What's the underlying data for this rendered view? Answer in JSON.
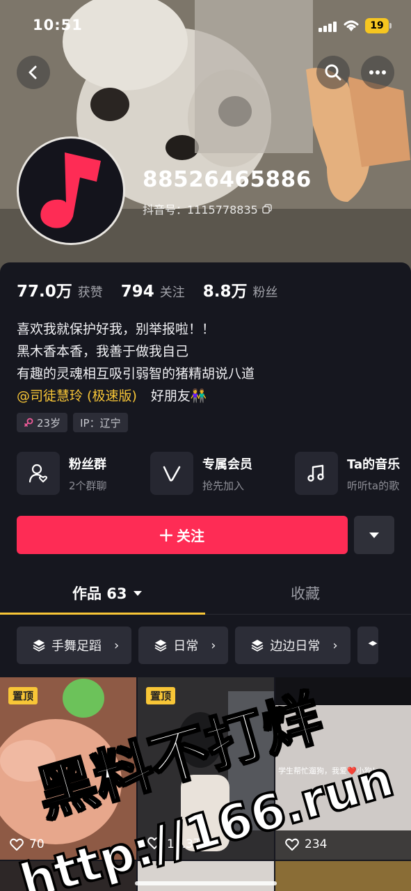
{
  "status_bar": {
    "time": "10:51",
    "battery": "19"
  },
  "profile": {
    "nickname": "88526465886",
    "douyin_id": "抖音号：1115778835"
  },
  "stats": [
    {
      "value": "77.0万",
      "label": "获赞"
    },
    {
      "value": "794",
      "label": "关注"
    },
    {
      "value": "8.8万",
      "label": "粉丝"
    }
  ],
  "bio": {
    "line1": "喜欢我就保护好我，别举报啦！！",
    "line2": "黑木香本香，我善于做我自己",
    "line3": "有趣的灵魂相互吸引弱智的猪精胡说八道",
    "mention": "@司徒慧玲 (极速版)",
    "mention_suffix": "好朋友👫"
  },
  "tags": {
    "age": "23岁",
    "ip": "IP：辽宁"
  },
  "features": [
    {
      "title": "粉丝群",
      "sub": "2个群聊",
      "icon": "fan-group-icon"
    },
    {
      "title": "专属会员",
      "sub": "抢先加入",
      "icon": "membership-icon"
    },
    {
      "title": "Ta的音乐",
      "sub": "听听ta的歌",
      "icon": "music-note-icon"
    }
  ],
  "follow_button": {
    "label": "关注"
  },
  "tabs": {
    "works": "作品 63",
    "favorites": "收藏"
  },
  "collections": [
    "手舞足蹈",
    "日常",
    "边边日常"
  ],
  "videos": [
    {
      "pinned": "置顶",
      "likes": "70"
    },
    {
      "pinned": "置顶",
      "likes": "15.3万"
    },
    {
      "pinned": "",
      "likes": "234",
      "caption": "学生帮忙遛狗，我爱❤️小狗！"
    }
  ],
  "watermark": {
    "line1": "黑料不打烊",
    "line2": "http://166.run"
  },
  "colors": {
    "accent_red": "#fe2c55",
    "accent_yellow": "#f8c637",
    "background": "#16171f"
  }
}
